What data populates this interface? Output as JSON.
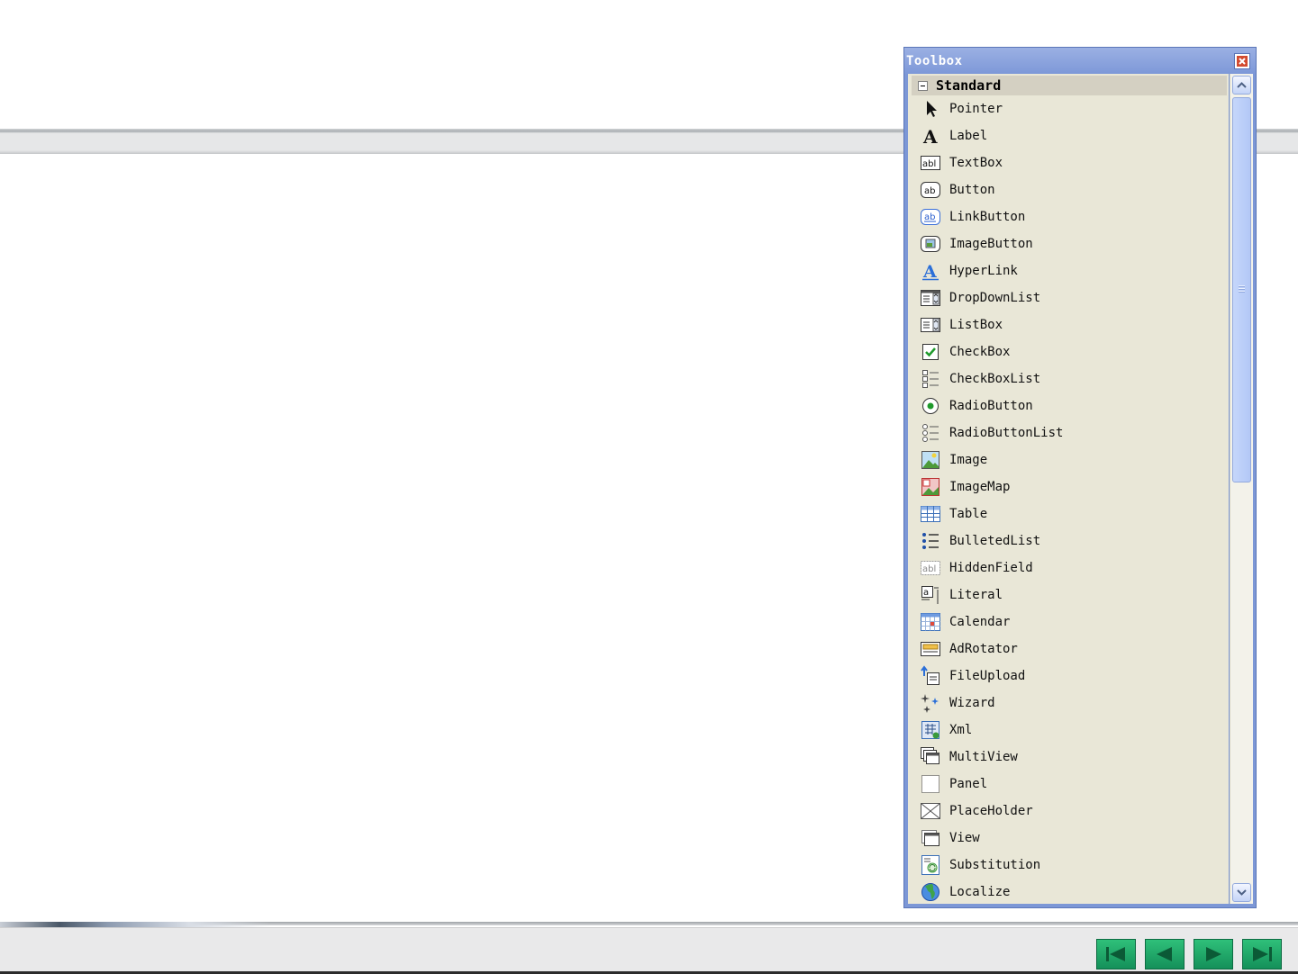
{
  "toolbox": {
    "title": "Toolbox",
    "category": "Standard",
    "items": [
      {
        "label": "Pointer",
        "icon": "pointer-icon"
      },
      {
        "label": "Label",
        "icon": "label-icon"
      },
      {
        "label": "TextBox",
        "icon": "textbox-icon"
      },
      {
        "label": "Button",
        "icon": "button-icon"
      },
      {
        "label": "LinkButton",
        "icon": "linkbutton-icon"
      },
      {
        "label": "ImageButton",
        "icon": "imagebutton-icon"
      },
      {
        "label": "HyperLink",
        "icon": "hyperlink-icon"
      },
      {
        "label": "DropDownList",
        "icon": "dropdownlist-icon"
      },
      {
        "label": "ListBox",
        "icon": "listbox-icon"
      },
      {
        "label": "CheckBox",
        "icon": "checkbox-icon"
      },
      {
        "label": "CheckBoxList",
        "icon": "checkboxlist-icon"
      },
      {
        "label": "RadioButton",
        "icon": "radiobutton-icon"
      },
      {
        "label": "RadioButtonList",
        "icon": "radiobuttonlist-icon"
      },
      {
        "label": "Image",
        "icon": "image-icon"
      },
      {
        "label": "ImageMap",
        "icon": "imagemap-icon"
      },
      {
        "label": "Table",
        "icon": "table-icon"
      },
      {
        "label": "BulletedList",
        "icon": "bulletedlist-icon"
      },
      {
        "label": "HiddenField",
        "icon": "hiddenfield-icon"
      },
      {
        "label": "Literal",
        "icon": "literal-icon"
      },
      {
        "label": "Calendar",
        "icon": "calendar-icon"
      },
      {
        "label": "AdRotator",
        "icon": "adrotator-icon"
      },
      {
        "label": "FileUpload",
        "icon": "fileupload-icon"
      },
      {
        "label": "Wizard",
        "icon": "wizard-icon"
      },
      {
        "label": "Xml",
        "icon": "xml-icon"
      },
      {
        "label": "MultiView",
        "icon": "multiview-icon"
      },
      {
        "label": "Panel",
        "icon": "panel-icon"
      },
      {
        "label": "PlaceHolder",
        "icon": "placeholder-icon"
      },
      {
        "label": "View",
        "icon": "view-icon"
      },
      {
        "label": "Substitution",
        "icon": "substitution-icon"
      },
      {
        "label": "Localize",
        "icon": "localize-icon"
      }
    ]
  },
  "navigation": {
    "buttons": [
      {
        "name": "first-slide-button",
        "icon": "skip-back-icon"
      },
      {
        "name": "previous-slide-button",
        "icon": "triangle-left-icon"
      },
      {
        "name": "next-slide-button",
        "icon": "triangle-right-icon"
      },
      {
        "name": "last-slide-button",
        "icon": "skip-forward-icon"
      }
    ]
  },
  "colors": {
    "toolbox_title": "#7d98d8",
    "toolbox_body": "#e9e7d7",
    "category_header": "#d4d0c2",
    "nav_button": "#14905a"
  }
}
